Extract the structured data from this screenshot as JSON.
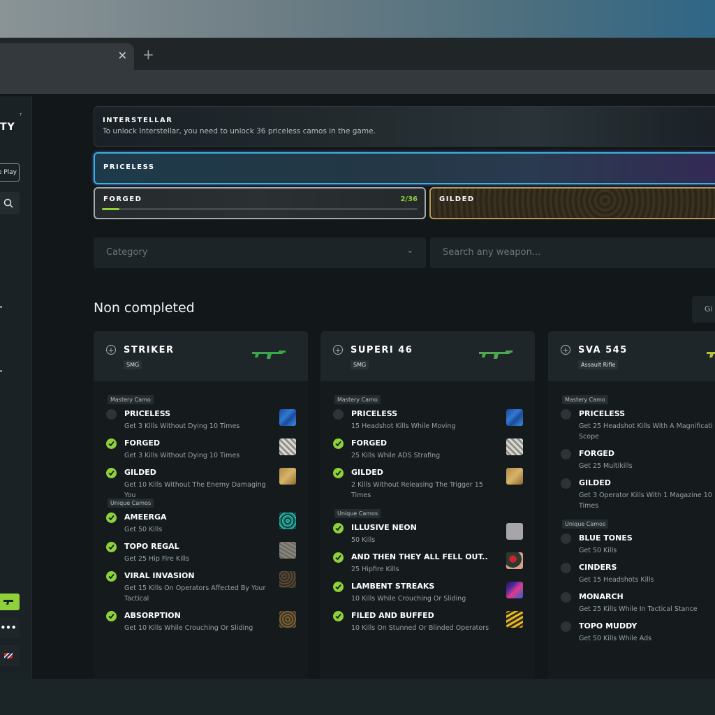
{
  "browser": {
    "tab_close": "✕",
    "new_tab": "+"
  },
  "sidebar": {
    "logo_small": "T",
    "logo_text": "TY",
    "play_label": "e Play",
    "more_label": "•••"
  },
  "mastery": {
    "interstellar": {
      "title": "INTERSTELLAR",
      "desc": "To unlock Interstellar, you need to unlock 36 priceless camos in the game."
    },
    "priceless": {
      "title": "PRICELESS"
    },
    "forged": {
      "title": "FORGED",
      "count": "2/36",
      "progress": 0.056
    },
    "gilded": {
      "title": "GILDED"
    }
  },
  "filters": {
    "category_placeholder": "Category",
    "search_placeholder": "Search any weapon..."
  },
  "section_title": "Non completed",
  "sort_label": "Gi",
  "colors": {
    "accent": "#8fd13a",
    "priceless_border": "#3ab2d8",
    "forged_border": "#a7aaab",
    "gilded_border": "#b89a5a"
  },
  "cards": [
    {
      "name": "STRIKER",
      "type": "SMG",
      "mastery_label": "Mastery Camo",
      "unique_label": "Unique Camos",
      "mastery": [
        {
          "name": "PRICELESS",
          "desc": "Get 3 Kills Without Dying 10 Times",
          "done": false,
          "swatch": "priceless"
        },
        {
          "name": "FORGED",
          "desc": "Get 3 Kills Without Dying 10 Times",
          "done": true,
          "swatch": "forged"
        },
        {
          "name": "GILDED",
          "desc": "Get 10 Kills Without The Enemy Damaging You",
          "done": true,
          "swatch": "gilded"
        }
      ],
      "unique": [
        {
          "name": "AMEERGA",
          "desc": "Get 50 Kills",
          "done": true,
          "swatch": "ameerga"
        },
        {
          "name": "TOPO REGAL",
          "desc": "Get 25 Hip Fire Kills",
          "done": true,
          "swatch": "topo"
        },
        {
          "name": "VIRAL INVASION",
          "desc": "Get 15 Kills On Operators Affected By Your Tactical",
          "done": true,
          "swatch": "viral"
        },
        {
          "name": "ABSORPTION",
          "desc": "Get 10 Kills While Crouching Or Sliding",
          "done": true,
          "swatch": "absorption"
        }
      ]
    },
    {
      "name": "SUPERI 46",
      "type": "SMG",
      "mastery_label": "Mastery Camo",
      "unique_label": "Unique Camos",
      "mastery": [
        {
          "name": "PRICELESS",
          "desc": "15 Headshot Kills While Moving",
          "done": false,
          "swatch": "priceless"
        },
        {
          "name": "FORGED",
          "desc": "25 Kills While ADS Strafing",
          "done": true,
          "swatch": "forged"
        },
        {
          "name": "GILDED",
          "desc": "2 Kills Without Releasing The Trigger 15 Times",
          "done": true,
          "swatch": "gilded"
        }
      ],
      "unique": [
        {
          "name": "ILLUSIVE NEON",
          "desc": "50 Kills",
          "done": true,
          "swatch": "illusive"
        },
        {
          "name": "AND THEN THEY ALL FELL OUT..",
          "desc": "25 Hipfire Kills",
          "done": true,
          "swatch": "fell"
        },
        {
          "name": "LAMBENT STREAKS",
          "desc": "10 Kills While Crouching Or Sliding",
          "done": true,
          "swatch": "lambent"
        },
        {
          "name": "FILED AND BUFFED",
          "desc": "10 Kills On Stunned Or Blinded Operators",
          "done": true,
          "swatch": "filed"
        }
      ]
    },
    {
      "name": "SVA 545",
      "type": "Assault Rifle",
      "mastery_label": "Mastery Camo",
      "unique_label": "Unique Camos",
      "mastery": [
        {
          "name": "PRICELESS",
          "desc": "Get 25 Headshot Kills With A Magnificati Scope",
          "done": false,
          "swatch": ""
        },
        {
          "name": "FORGED",
          "desc": "Get 25 Multikills",
          "done": false,
          "swatch": ""
        },
        {
          "name": "GILDED",
          "desc": "Get 3 Operator Kills With 1 Magazine 10 Times",
          "done": false,
          "swatch": ""
        }
      ],
      "unique": [
        {
          "name": "BLUE TONES",
          "desc": "Get 50 Kills",
          "done": false,
          "swatch": ""
        },
        {
          "name": "CINDERS",
          "desc": "Get 15 Headshots Kills",
          "done": false,
          "swatch": ""
        },
        {
          "name": "MONARCH",
          "desc": "Get 25 Kills While In Tactical Stance",
          "done": false,
          "swatch": ""
        },
        {
          "name": "TOPO MUDDY",
          "desc": "Get 50 Kills While Ads",
          "done": false,
          "swatch": ""
        }
      ]
    }
  ]
}
